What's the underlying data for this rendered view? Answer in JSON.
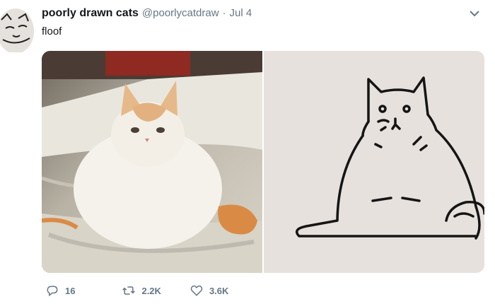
{
  "tweet": {
    "author_name": "poorly drawn cats",
    "handle": "@poorlycatdraw",
    "separator": "·",
    "date": "Jul 4",
    "text": "floof"
  },
  "media": {
    "left_photo": "photo-of-white-orange-cat",
    "right_photo": "line-drawing-of-cat"
  },
  "actions": {
    "reply_count": "16",
    "retweet_count": "2.2K",
    "like_count": "3.6K"
  },
  "icons": {
    "reply": "reply-icon",
    "retweet": "retweet-icon",
    "like": "heart-icon",
    "menu": "chevron-down-icon"
  },
  "colors": {
    "text": "#14171a",
    "muted": "#657786"
  }
}
